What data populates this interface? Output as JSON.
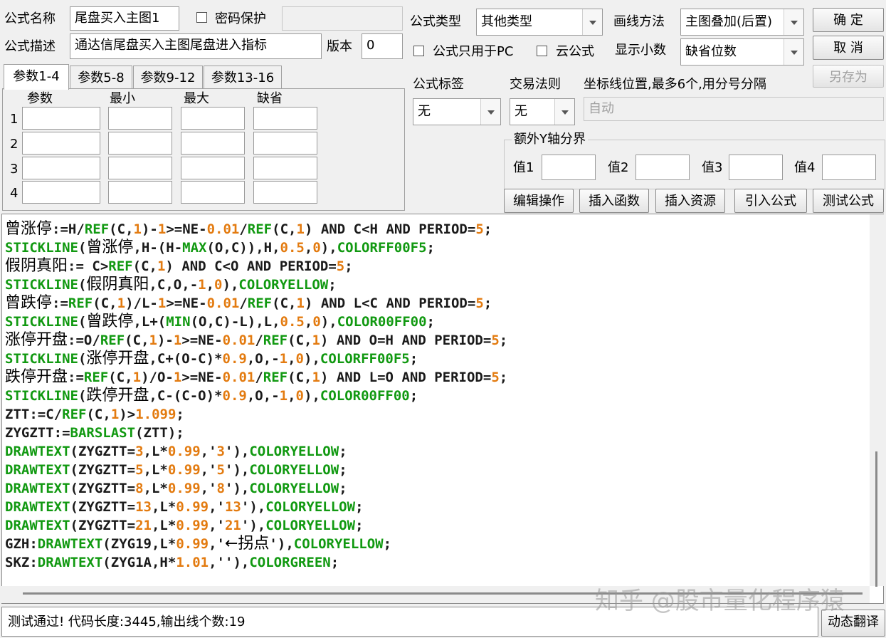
{
  "form": {
    "name_label": "公式名称",
    "name_value": "尾盘买入主图1",
    "password_label": "密码保护",
    "password_value": "",
    "desc_label": "公式描述",
    "desc_value": "通达信尾盘买入主图尾盘进入指标",
    "version_label": "版本",
    "version_value": "0",
    "type_label": "公式类型",
    "type_value": "其他类型",
    "draw_label": "画线方法",
    "draw_value": "主图叠加(后置)",
    "pc_only_label": "公式只用于PC",
    "cloud_label": "云公式",
    "decimals_label": "显示小数",
    "decimals_value": "缺省位数",
    "tag_label": "公式标签",
    "tag_value": "无",
    "trade_label": "交易法则",
    "trade_value": "无",
    "coord_label": "坐标线位置,最多6个,用分号分隔",
    "coord_value": "自动",
    "extra_y_label": "额外Y轴分界",
    "val_labels": [
      "值1",
      "值2",
      "值3",
      "值4"
    ]
  },
  "buttons": {
    "ok": "确  定",
    "cancel": "取  消",
    "save_as": "另存为",
    "edit_ops": "编辑操作",
    "insert_func": "插入函数",
    "insert_res": "插入资源",
    "import_formula": "引入公式",
    "test_formula": "测试公式",
    "dynamic_translate": "动态翻译"
  },
  "tabs": [
    "参数1-4",
    "参数5-8",
    "参数9-12",
    "参数13-16"
  ],
  "params": {
    "headers": [
      "参数",
      "最小",
      "最大",
      "缺省"
    ],
    "rows": [
      "1",
      "2",
      "3",
      "4"
    ]
  },
  "code_lines": [
    "曾涨停:=H/REF(C,1)-1>=NE-0.01/REF(C,1) AND C<H AND PERIOD=5;",
    "STICKLINE(曾涨停,H-(H-MAX(O,C)),H,0.5,0),COLORFF00F5;",
    "假阴真阳:= C>REF(C,1) AND C<O AND PERIOD=5;",
    "STICKLINE(假阴真阳,C,O,-1,0),COLORYELLOW;",
    "曾跌停:=REF(C,1)/L-1>=NE-0.01/REF(C,1) AND L<C AND PERIOD=5;",
    "STICKLINE(曾跌停,L+(MIN(O,C)-L),L,0.5,0),COLOR00FF00;",
    "涨停开盘:=O/REF(C,1)-1>=NE-0.01/REF(C,1) AND O=H AND PERIOD=5;",
    "STICKLINE(涨停开盘,C+(O-C)*0.9,O,-1,0),COLORFF00F5;",
    "跌停开盘:=REF(C,1)/O-1>=NE-0.01/REF(C,1) AND L=O AND PERIOD=5;",
    "STICKLINE(跌停开盘,C-(C-O)*0.9,O,-1,0),COLOR00FF00;",
    "ZTT:=C/REF(C,1)>1.099;",
    "ZYGZTT:=BARSLAST(ZTT);",
    "DRAWTEXT(ZYGZTT=3,L*0.99,'3'),COLORYELLOW;",
    "DRAWTEXT(ZYGZTT=5,L*0.99,'5'),COLORYELLOW;",
    "DRAWTEXT(ZYGZTT=8,L*0.99,'8'),COLORYELLOW;",
    "DRAWTEXT(ZYGZTT=13,L*0.99,'13'),COLORYELLOW;",
    "DRAWTEXT(ZYGZTT=21,L*0.99,'21'),COLORYELLOW;",
    "GZH:DRAWTEXT(ZYG19,L*0.99,'←拐点'),COLORYELLOW;",
    "SKZ:DRAWTEXT(ZYG1A,H*1.01,''),COLORGREEN;"
  ],
  "status_text": "测试通过! 代码长度:3445,输出线个数:19",
  "watermark": "知乎 @股市量化程序猿",
  "colors": {
    "function": "#119911",
    "number": "#e37b10",
    "text": "#1a1a1a"
  }
}
